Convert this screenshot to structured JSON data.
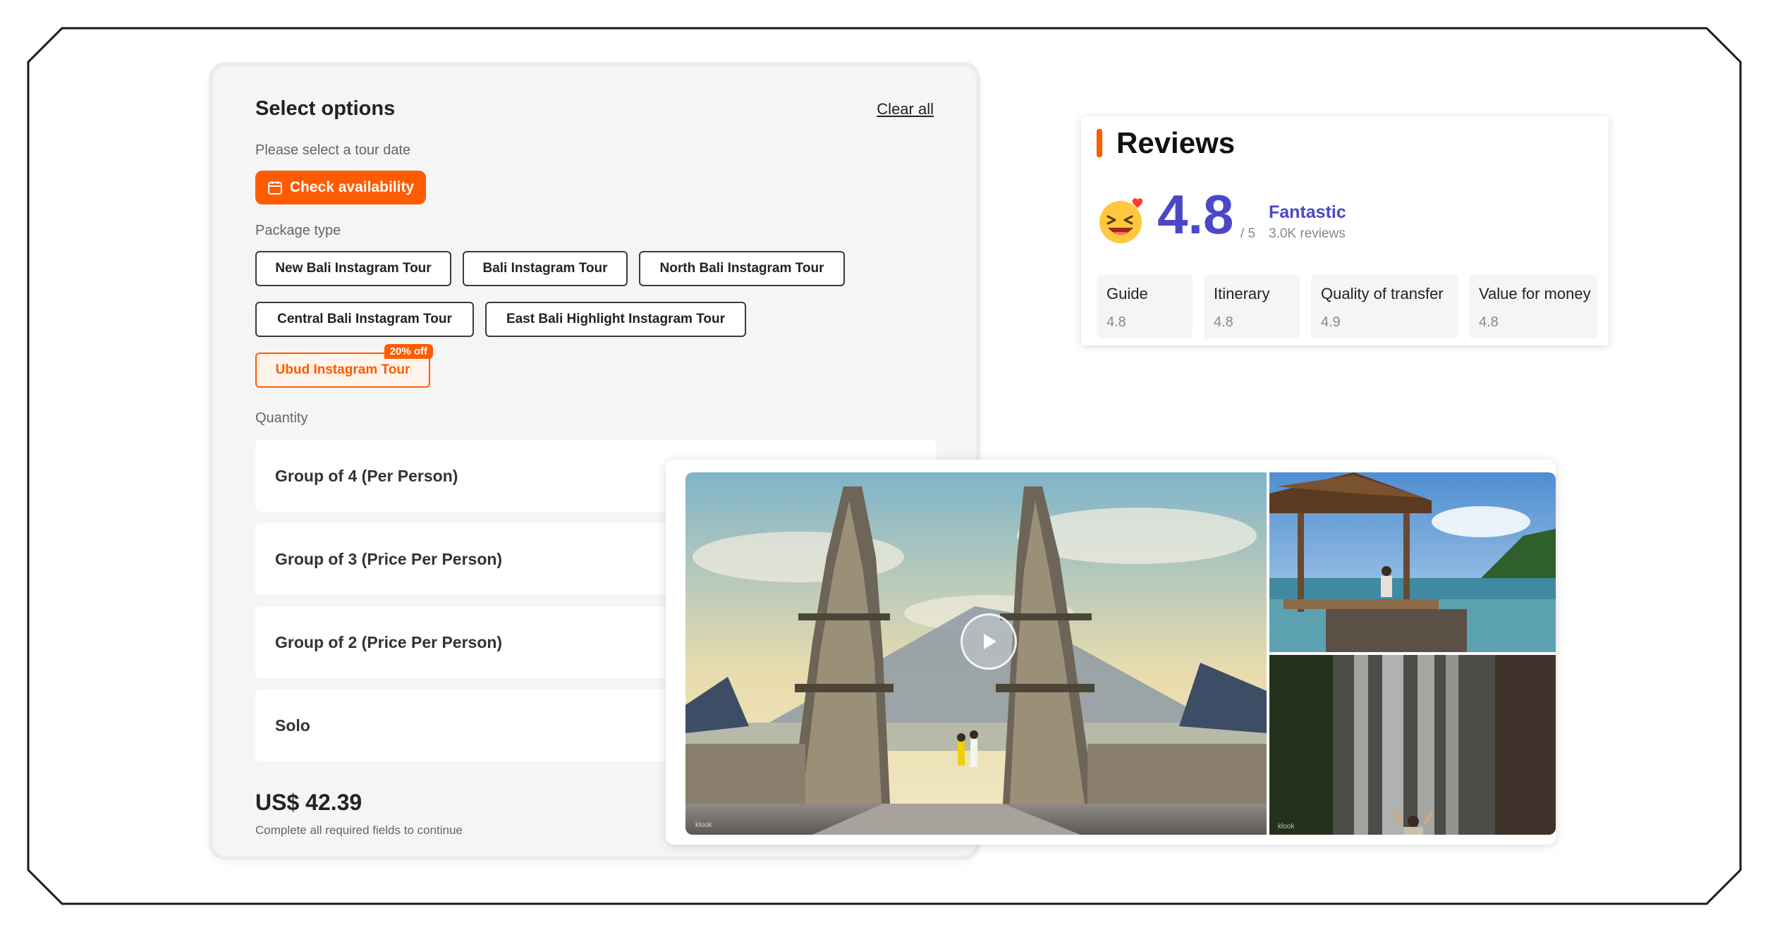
{
  "options": {
    "title": "Select options",
    "clear_all": "Clear all",
    "date_label": "Please select a tour date",
    "check_availability": "Check availability",
    "package_label": "Package type",
    "packages": [
      "New Bali Instagram Tour",
      "Bali Instagram Tour",
      "North Bali Instagram Tour",
      "Central Bali Instagram Tour",
      "East Bali Highlight Instagram Tour",
      "Ubud Instagram Tour"
    ],
    "selected_package": "Ubud Instagram Tour",
    "discount_badge": "20% off",
    "quantity_label": "Quantity",
    "quantities": [
      "Group of 4 (Per Person)",
      "Group of 3 (Price Per Person)",
      "Group of 2 (Price Per Person)",
      "Solo"
    ],
    "price": "US$ 42.39",
    "price_note": "Complete all required fields to continue"
  },
  "reviews": {
    "title": "Reviews",
    "score": "4.8",
    "out_of": "/ 5",
    "verdict": "Fantastic",
    "count": "3.0K reviews",
    "subscores": [
      {
        "name": "Guide",
        "value": "4.8"
      },
      {
        "name": "Itinerary",
        "value": "4.8"
      },
      {
        "name": "Quality of transfer",
        "value": "4.9"
      },
      {
        "name": "Value for money",
        "value": "4.8"
      }
    ]
  },
  "gallery": {
    "watermark": "klook"
  },
  "colors": {
    "accent": "#ff5b00",
    "rating": "#4b48c8"
  },
  "icons": {
    "calendar": "calendar-icon",
    "play": "play-icon",
    "emoji": "laughing-emoji-icon"
  }
}
